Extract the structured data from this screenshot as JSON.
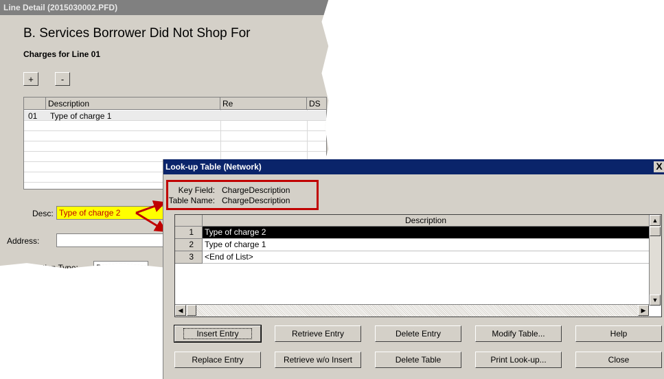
{
  "line_detail": {
    "title": "Line Detail (2015030002.PFD)",
    "heading": "B. Services Borrower Did Not Shop For",
    "subheading": "Charges for Line 01",
    "add_label": "+",
    "remove_label": "-",
    "columns": [
      "Description",
      "Re",
      "DS"
    ],
    "rows": [
      {
        "num": "01",
        "desc": "Type of charge 1"
      }
    ],
    "desc_label": "Desc:",
    "desc_value": "Type of charge 2",
    "address_label": "Address:",
    "address_value": "",
    "calc_label": "Calculation Type:",
    "calc_value": "Basic"
  },
  "lookup": {
    "title": "Look-up Table (Network)",
    "close_label": "X",
    "key_field_label": "Key Field:",
    "key_field_value": "ChargeDescription",
    "table_name_label": "Table Name:",
    "table_name_value": "ChargeDescription",
    "column_header": "Description",
    "rows": [
      {
        "num": "1",
        "text": "Type of charge 2"
      },
      {
        "num": "2",
        "text": "Type of charge 1"
      },
      {
        "num": "3",
        "text": "<End of List>"
      }
    ],
    "buttons": {
      "insert": "Insert Entry",
      "retrieve": "Retrieve Entry",
      "delete": "Delete Entry",
      "modify": "Modify Table...",
      "help": "Help",
      "replace": "Replace Entry",
      "retrieve_no_insert": "Retrieve w/o Insert",
      "delete_table": "Delete Table",
      "print": "Print Look-up...",
      "close": "Close"
    }
  },
  "colors": {
    "highlight_box": "#c00000",
    "desc_field_bg": "#ffff00",
    "desc_field_text": "#c00000",
    "active_title": "#0a246a",
    "inactive_title": "#808080"
  }
}
